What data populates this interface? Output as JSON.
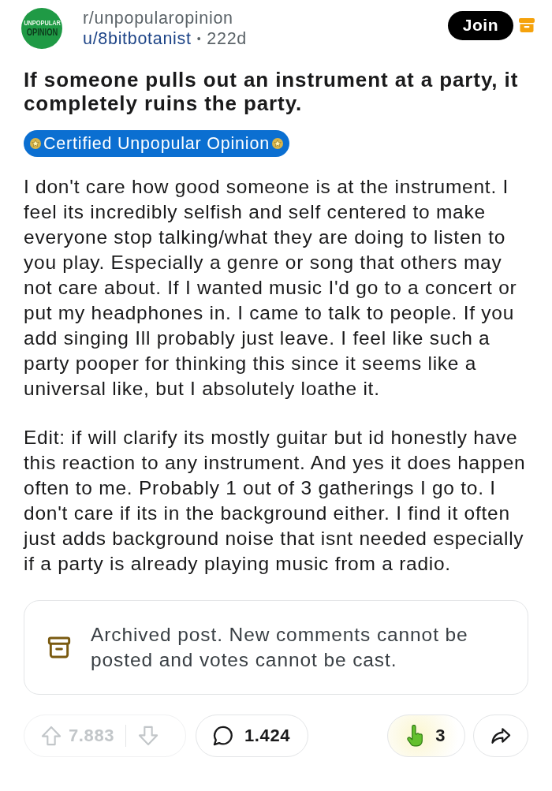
{
  "post_header": {
    "avatar": {
      "top_text": "UNPOPULAR",
      "bottom_text": "OPINION"
    },
    "subreddit": "r/unpopularopinion",
    "author": "u/8bitbotanist",
    "separator": "•",
    "age": "222d",
    "join_button": "Join"
  },
  "post": {
    "title": "If someone pulls out an instrument at a party, it completely ruins the party.",
    "flair": "Certified Unpopular Opinion",
    "body": [
      "I don't care how good someone is at the instrument. I feel its incredibly selfish and self centered to make everyone stop talking/what they are doing to listen to you play. Especially a genre or song that others may not care about. If I wanted music I'd go to a concert or put my headphones in. I came to talk to people. If you add singing Ill probably just leave. I feel like such a party pooper for thinking this since it seems like a universal like, but I absolutely loathe it.",
      "Edit: if will clarify its mostly guitar but id honestly have this reaction to any instrument. And yes it does happen often to me. Probably 1 out of 3 gatherings I go to. I don't care if its in the background either. I find it often just adds background noise that isnt needed especially if a party is already playing music from a radio."
    ]
  },
  "archived_notice": {
    "text": "Archived post. New comments cannot be posted and votes cannot be cast."
  },
  "actions": {
    "votes": {
      "count": "7.883",
      "disabled": true
    },
    "comments": {
      "count": "1.424"
    },
    "awards": {
      "count": "3"
    }
  }
}
